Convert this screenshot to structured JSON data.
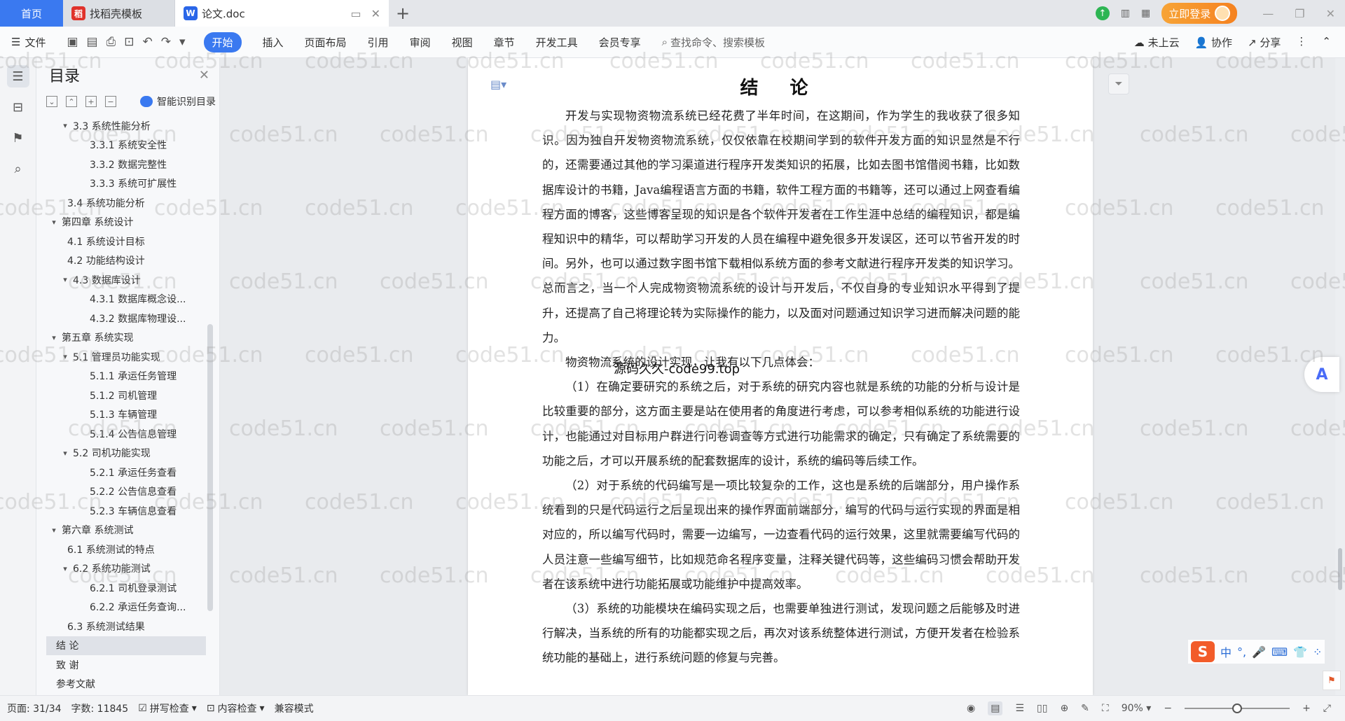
{
  "tabs": {
    "home": "首页",
    "template_tab": "找稻壳模板",
    "doc_tab": "论文.doc",
    "login": "立即登录"
  },
  "toolbar": {
    "file": "文件",
    "menus": [
      "开始",
      "插入",
      "页面布局",
      "引用",
      "审阅",
      "视图",
      "章节",
      "开发工具",
      "会员专享"
    ],
    "active_menu": "开始",
    "search": "查找命令、搜索模板",
    "cloud": "未上云",
    "collab": "协作",
    "share": "分享"
  },
  "toc": {
    "title": "目录",
    "smart": "智能识别目录",
    "items": [
      {
        "label": "3.3 系统性能分析",
        "level": 2,
        "caret": "v"
      },
      {
        "label": "3.3.1 系统安全性",
        "level": 3,
        "caret": ""
      },
      {
        "label": "3.3.2 数据完整性",
        "level": 3,
        "caret": ""
      },
      {
        "label": "3.3.3 系统可扩展性",
        "level": 3,
        "caret": ""
      },
      {
        "label": "3.4 系统功能分析",
        "level": 2,
        "caret": ""
      },
      {
        "label": "第四章  系统设计",
        "level": 1,
        "caret": "v"
      },
      {
        "label": "4.1  系统设计目标",
        "level": 2,
        "caret": ""
      },
      {
        "label": "4.2 功能结构设计",
        "level": 2,
        "caret": ""
      },
      {
        "label": "4.3 数据库设计",
        "level": 2,
        "caret": "v"
      },
      {
        "label": "4.3.1  数据库概念设...",
        "level": 3,
        "caret": ""
      },
      {
        "label": "4.3.2  数据库物理设...",
        "level": 3,
        "caret": ""
      },
      {
        "label": "第五章  系统实现",
        "level": 1,
        "caret": "v"
      },
      {
        "label": "5.1 管理员功能实现",
        "level": 2,
        "caret": "v"
      },
      {
        "label": "5.1.1  承运任务管理",
        "level": 3,
        "caret": ""
      },
      {
        "label": "5.1.2  司机管理",
        "level": 3,
        "caret": ""
      },
      {
        "label": "5.1.3  车辆管理",
        "level": 3,
        "caret": ""
      },
      {
        "label": "5.1.4  公告信息管理",
        "level": 3,
        "caret": ""
      },
      {
        "label": "5.2 司机功能实现",
        "level": 2,
        "caret": "v"
      },
      {
        "label": "5.2.1  承运任务查看",
        "level": 3,
        "caret": ""
      },
      {
        "label": "5.2.2  公告信息查看",
        "level": 3,
        "caret": ""
      },
      {
        "label": "5.2.3  车辆信息查看",
        "level": 3,
        "caret": ""
      },
      {
        "label": "第六章  系统测试",
        "level": 1,
        "caret": "v"
      },
      {
        "label": "6.1 系统测试的特点",
        "level": 2,
        "caret": ""
      },
      {
        "label": "6.2  系统功能测试",
        "level": 2,
        "caret": "v"
      },
      {
        "label": "6.2.1  司机登录测试",
        "level": 3,
        "caret": ""
      },
      {
        "label": "6.2.2  承运任务查询...",
        "level": 3,
        "caret": ""
      },
      {
        "label": "6.3  系统测试结果",
        "level": 2,
        "caret": ""
      },
      {
        "label": "结    论",
        "level": 1,
        "caret": "",
        "selected": true
      },
      {
        "label": "致    谢",
        "level": 1,
        "caret": ""
      },
      {
        "label": "参考文献",
        "level": 1,
        "caret": ""
      }
    ]
  },
  "document": {
    "title": "结 论",
    "paragraphs": [
      "开发与实现物资物流系统已经花费了半年时间，在这期间，作为学生的我收获了很多知识。因为独自开发物资物流系统，仅仅依靠在校期间学到的软件开发方面的知识显然是不行的，还需要通过其他的学习渠道进行程序开发类知识的拓展，比如去图书馆借阅书籍，比如数据库设计的书籍，Java编程语言方面的书籍，软件工程方面的书籍等，还可以通过上网查看编程方面的博客，这些博客呈现的知识是各个软件开发者在工作生涯中总结的编程知识，都是编程知识中的精华，可以帮助学习开发的人员在编程中避免很多开发误区，还可以节省开发的时间。另外，也可以通过数字图书馆下载相似系统方面的参考文献进行程序开发类的知识学习。总而言之，当一个人完成物资物流系统的设计与开发后，不仅自身的专业知识水平得到了提升，还提高了自己将理论转为实际操作的能力，以及面对问题通过知识学习进而解决问题的能力。",
      "物资物流系统的设计实现，让我有以下几点体会：",
      "（1）在确定要研究的系统之后，对于系统的研究内容也就是系统的功能的分析与设计是比较重要的部分，这方面主要是站在使用者的角度进行考虑，可以参考相似系统的功能进行设计，也能通过对目标用户群进行问卷调查等方式进行功能需求的确定，只有确定了系统需要的功能之后，才可以开展系统的配套数据库的设计，系统的编码等后续工作。",
      "（2）对于系统的代码编写是一项比较复杂的工作，这也是系统的后端部分，用户操作系统看到的只是代码运行之后呈现出来的操作界面前端部分，编写的代码与运行实现的界面是相对应的，所以编写代码时，需要一边编写，一边查看代码的运行效果，这里就需要编写代码的人员注意一些编写细节，比如规范命名程序变量，注释关键代码等，这些编码习惯会帮助开发者在该系统中进行功能拓展或功能维护中提高效率。",
      "（3）系统的功能模块在编码实现之后，也需要单独进行测试，发现问题之后能够及时进行解决，当系统的所有的功能都实现之后，再次对该系统整体进行测试，方便开发者在检验系统功能的基础上，进行系统问题的修复与完善。"
    ],
    "overlay": "源码久久-code99.top"
  },
  "watermark": "code51.cn",
  "ime": {
    "lang": "中",
    "punct": "°,"
  },
  "status": {
    "page": "页面: 31/34",
    "words": "字数: 11845",
    "spell": "拼写检查",
    "content_check": "内容检查",
    "compat": "兼容模式",
    "zoom": "90%",
    "zoom_fraction": 0.5
  },
  "colors": {
    "accent": "#3a79f0",
    "login": "#f58220"
  }
}
